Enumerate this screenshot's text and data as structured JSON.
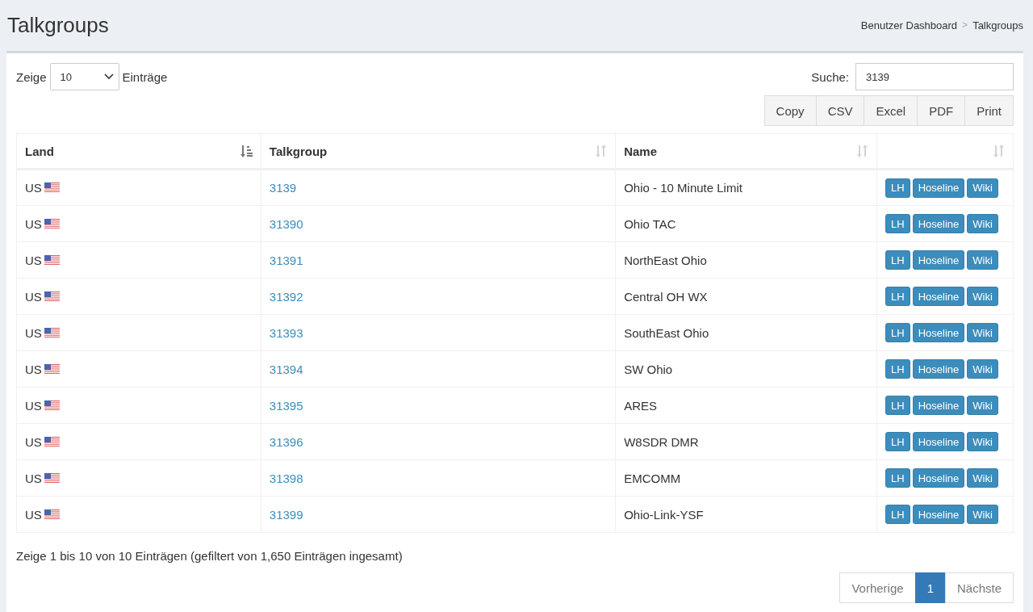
{
  "page": {
    "title": "Talkgroups"
  },
  "breadcrumb": [
    {
      "label": "Benutzer Dashboard",
      "separator": ">"
    },
    {
      "label": "Talkgroups"
    }
  ],
  "length": {
    "prefix": "Zeige",
    "value": "10",
    "suffix": "Einträge"
  },
  "search": {
    "label": "Suche:",
    "value": "3139"
  },
  "export_buttons": [
    "Copy",
    "CSV",
    "Excel",
    "PDF",
    "Print"
  ],
  "table": {
    "columns": [
      {
        "label": "Land",
        "sorted": true
      },
      {
        "label": "Talkgroup",
        "sorted": false
      },
      {
        "label": "Name",
        "sorted": false
      },
      {
        "sorted": false
      }
    ],
    "rows": [
      {
        "land": "US",
        "talkgroup": "3139",
        "name": "Ohio - 10 Minute Limit",
        "actions": [
          "LH",
          "Hoseline",
          "Wiki"
        ]
      },
      {
        "land": "US",
        "talkgroup": "31390",
        "name": "Ohio TAC",
        "actions": [
          "LH",
          "Hoseline",
          "Wiki"
        ]
      },
      {
        "land": "US",
        "talkgroup": "31391",
        "name": "NorthEast Ohio",
        "actions": [
          "LH",
          "Hoseline",
          "Wiki"
        ]
      },
      {
        "land": "US",
        "talkgroup": "31392",
        "name": "Central OH WX",
        "actions": [
          "LH",
          "Hoseline",
          "Wiki"
        ]
      },
      {
        "land": "US",
        "talkgroup": "31393",
        "name": "SouthEast Ohio",
        "actions": [
          "LH",
          "Hoseline",
          "Wiki"
        ]
      },
      {
        "land": "US",
        "talkgroup": "31394",
        "name": "SW Ohio",
        "actions": [
          "LH",
          "Hoseline",
          "Wiki"
        ]
      },
      {
        "land": "US",
        "talkgroup": "31395",
        "name": "ARES",
        "actions": [
          "LH",
          "Hoseline",
          "Wiki"
        ]
      },
      {
        "land": "US",
        "talkgroup": "31396",
        "name": "W8SDR DMR",
        "actions": [
          "LH",
          "Hoseline",
          "Wiki"
        ]
      },
      {
        "land": "US",
        "talkgroup": "31398",
        "name": "EMCOMM",
        "actions": [
          "LH",
          "Hoseline",
          "Wiki"
        ]
      },
      {
        "land": "US",
        "talkgroup": "31399",
        "name": "Ohio-Link-YSF",
        "actions": [
          "LH",
          "Hoseline",
          "Wiki"
        ]
      }
    ]
  },
  "info": "Zeige 1 bis 10 von 10 Einträgen (gefiltert von 1,650 Einträgen ingesamt)",
  "pagination": [
    {
      "label": "Vorherige",
      "selected": false
    },
    {
      "label": "1",
      "selected": true
    },
    {
      "label": "Nächste",
      "selected": false
    }
  ]
}
